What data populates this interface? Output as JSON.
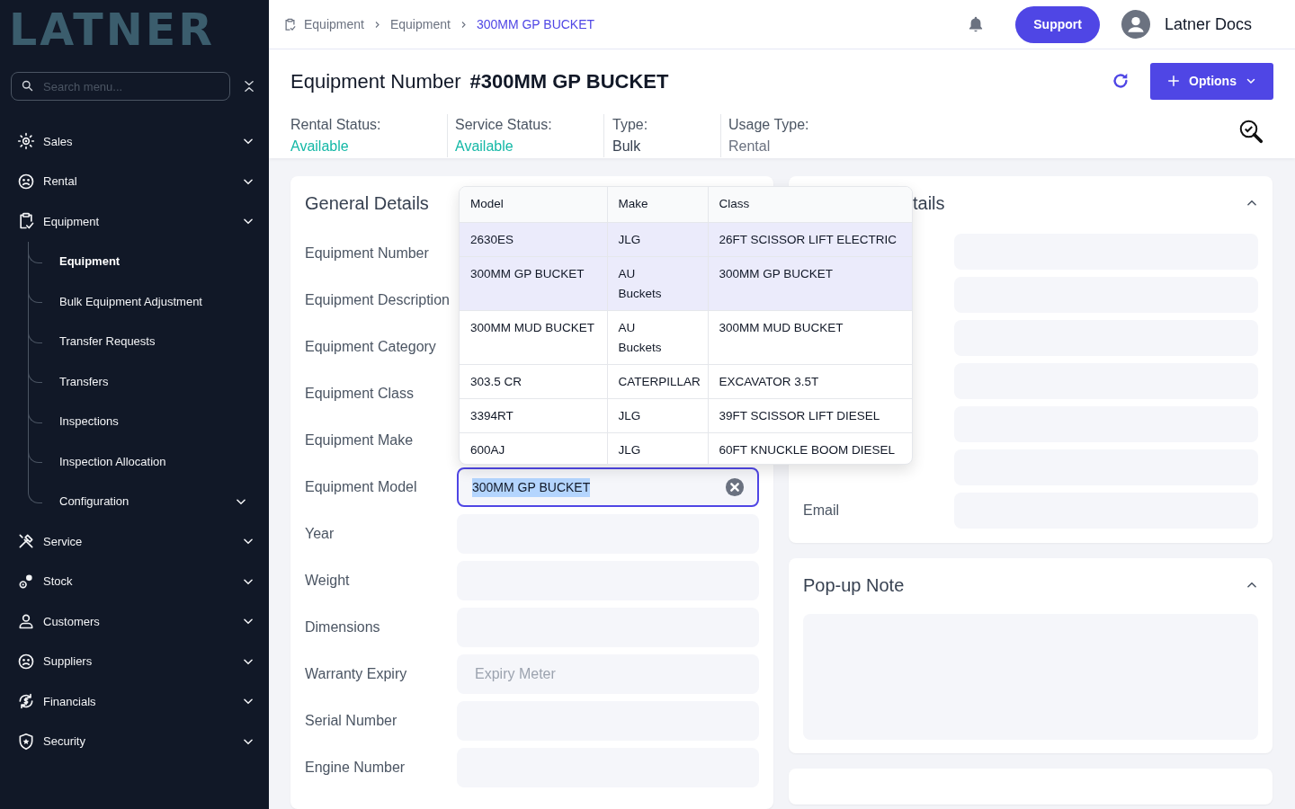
{
  "sidebar": {
    "logo": "LATNER",
    "search": {
      "placeholder": "Search menu..."
    },
    "items": [
      {
        "label": "Sales"
      },
      {
        "label": "Rental"
      },
      {
        "label": "Equipment",
        "children": [
          {
            "label": "Equipment",
            "selected": true,
            "kind": "link"
          },
          {
            "label": "Bulk Equipment Adjustment",
            "selected": false,
            "kind": "link"
          },
          {
            "label": "Transfer Requests",
            "selected": false,
            "kind": "link"
          },
          {
            "label": "Transfers",
            "selected": false,
            "kind": "link"
          },
          {
            "label": "Inspections",
            "selected": false,
            "kind": "link"
          },
          {
            "label": "Inspection Allocation",
            "selected": false,
            "kind": "link"
          },
          {
            "label": "Configuration",
            "selected": false,
            "kind": "group"
          }
        ]
      },
      {
        "label": "Service"
      },
      {
        "label": "Stock"
      },
      {
        "label": "Customers"
      },
      {
        "label": "Suppliers"
      },
      {
        "label": "Financials"
      },
      {
        "label": "Security"
      }
    ]
  },
  "header": {
    "breadcrumbs": [
      {
        "label": "Equipment",
        "current": false
      },
      {
        "label": "Equipment",
        "current": false
      },
      {
        "label": "300MM GP BUCKET",
        "current": true
      }
    ],
    "support": "Support",
    "user": "Latner Docs"
  },
  "title": {
    "label": "Equipment Number",
    "number": "#300MM GP BUCKET",
    "options": "Options"
  },
  "statuses": [
    {
      "label": "Rental Status:",
      "value": "Available",
      "color": "#14b8a6"
    },
    {
      "label": "Service Status:",
      "value": "Available",
      "color": "#14b8a6"
    },
    {
      "label": "Type:",
      "value": "Bulk",
      "color": "#374151"
    },
    {
      "label": "Usage Type:",
      "value": "Rental",
      "color": "#6b7280"
    }
  ],
  "general": {
    "title": "General Details",
    "rows": [
      {
        "label": "Equipment Number",
        "kind": "covered"
      },
      {
        "label": "Equipment Description",
        "kind": "covered"
      },
      {
        "label": "Equipment Category",
        "kind": "covered"
      },
      {
        "label": "Equipment Class",
        "kind": "covered"
      },
      {
        "label": "Equipment Make",
        "kind": "covered"
      },
      {
        "label": "Equipment Model",
        "kind": "combo",
        "value": "300MM GP BUCKET",
        "text_selected": true
      },
      {
        "label": "Year",
        "kind": "text"
      },
      {
        "label": "Weight",
        "kind": "text"
      },
      {
        "label": "Dimensions",
        "kind": "text"
      },
      {
        "label": "Warranty Expiry",
        "kind": "text",
        "placeholder": "Expiry Meter"
      },
      {
        "label": "Serial Number",
        "kind": "text"
      },
      {
        "label": "Engine Number",
        "kind": "text"
      }
    ]
  },
  "contact": {
    "title": "tails",
    "expanded": true,
    "rows": [
      {
        "kind": "text"
      },
      {
        "kind": "text"
      },
      {
        "kind": "text"
      },
      {
        "kind": "text"
      },
      {
        "kind": "text"
      },
      {
        "kind": "text"
      },
      {
        "kind": "text",
        "label": "Email"
      }
    ]
  },
  "popup_note": {
    "title": "Pop-up Note",
    "expanded": true
  },
  "dropdown": {
    "columns": [
      "Model",
      "Make",
      "Class"
    ],
    "rows": [
      {
        "cells": [
          "2630ES",
          "JLG",
          "26FT SCISSOR LIFT ELECTRIC"
        ],
        "highlighted": true
      },
      {
        "cells": [
          "300MM GP BUCKET",
          "AU Buckets",
          "300MM GP BUCKET"
        ],
        "highlighted": true
      },
      {
        "cells": [
          "300MM MUD BUCKET",
          "AU Buckets",
          "300MM MUD BUCKET"
        ],
        "highlighted": false
      },
      {
        "cells": [
          "303.5 CR",
          "CATERPILLAR",
          "EXCAVATOR 3.5T"
        ],
        "highlighted": false
      },
      {
        "cells": [
          "3394RT",
          "JLG",
          "39FT SCISSOR LIFT DIESEL"
        ],
        "highlighted": false
      },
      {
        "cells": [
          "600AJ",
          "JLG",
          "60FT KNUCKLE BOOM DIESEL"
        ],
        "highlighted": false
      }
    ]
  }
}
